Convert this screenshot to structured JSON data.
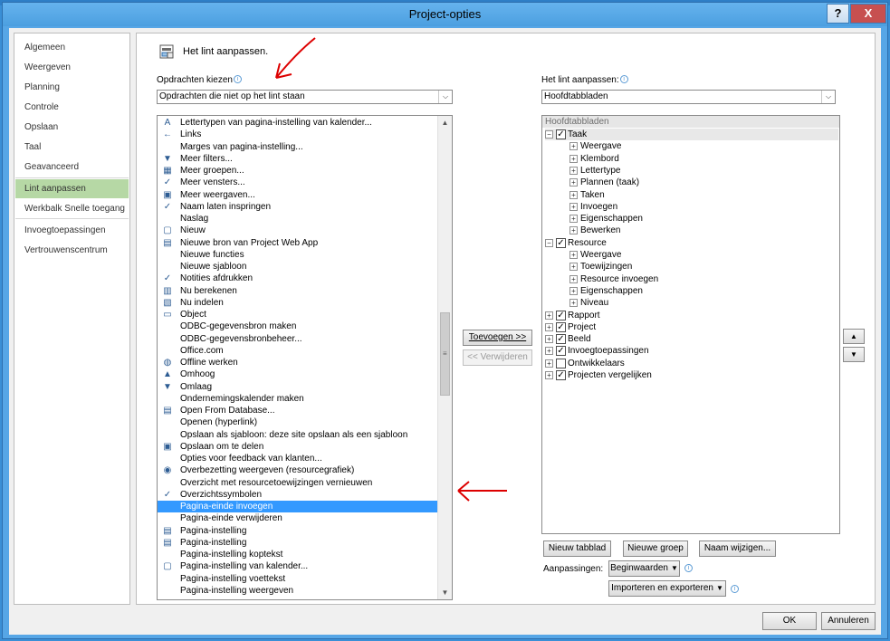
{
  "window": {
    "title": "Project-opties",
    "help": "?",
    "close": "X"
  },
  "nav": {
    "items": [
      {
        "label": "Algemeen"
      },
      {
        "label": "Weergeven"
      },
      {
        "label": "Planning"
      },
      {
        "label": "Controle"
      },
      {
        "label": "Opslaan"
      },
      {
        "label": "Taal"
      },
      {
        "label": "Geavanceerd"
      },
      {
        "label": "Lint aanpassen"
      },
      {
        "label": "Werkbalk Snelle toegang"
      },
      {
        "label": "Invoegtoepassingen"
      },
      {
        "label": "Vertrouwenscentrum"
      }
    ],
    "selected_index": 7
  },
  "header": {
    "title": "Het lint aanpassen."
  },
  "left": {
    "label": "Opdrachten kiezen",
    "combo_value": "Opdrachten die niet op het lint staan",
    "commands": [
      {
        "icon": "font-icon",
        "glyph": "A",
        "label": "Lettertypen van pagina-instelling van kalender..."
      },
      {
        "icon": "arrow-left-icon",
        "glyph": "←",
        "label": "Links"
      },
      {
        "icon": "",
        "glyph": "",
        "label": "Marges van pagina-instelling..."
      },
      {
        "icon": "filter-icon",
        "glyph": "▼",
        "label": "Meer filters..."
      },
      {
        "icon": "groups-icon",
        "glyph": "▦",
        "label": "Meer groepen..."
      },
      {
        "icon": "check-icon",
        "glyph": "✓",
        "label": "Meer vensters..."
      },
      {
        "icon": "views-icon",
        "glyph": "▣",
        "label": "Meer weergaven..."
      },
      {
        "icon": "check-icon",
        "glyph": "✓",
        "label": "Naam laten inspringen"
      },
      {
        "icon": "",
        "glyph": "",
        "label": "Naslag"
      },
      {
        "icon": "new-icon",
        "glyph": "▢",
        "label": "Nieuw"
      },
      {
        "icon": "web-app-icon",
        "glyph": "▤",
        "label": "Nieuwe bron van Project Web App"
      },
      {
        "icon": "",
        "glyph": "",
        "label": "Nieuwe functies"
      },
      {
        "icon": "",
        "glyph": "",
        "label": "Nieuwe sjabloon"
      },
      {
        "icon": "check-icon",
        "glyph": "✓",
        "label": "Notities afdrukken"
      },
      {
        "icon": "calculator-icon",
        "glyph": "▥",
        "label": "Nu berekenen"
      },
      {
        "icon": "level-icon",
        "glyph": "▧",
        "label": "Nu indelen"
      },
      {
        "icon": "object-icon",
        "glyph": "▭",
        "label": "Object"
      },
      {
        "icon": "",
        "glyph": "",
        "label": "ODBC-gegevensbron maken"
      },
      {
        "icon": "",
        "glyph": "",
        "label": "ODBC-gegevensbronbeheer..."
      },
      {
        "icon": "",
        "glyph": "",
        "label": "Office.com"
      },
      {
        "icon": "globe-icon",
        "glyph": "◍",
        "label": "Offline werken"
      },
      {
        "icon": "up-icon",
        "glyph": "▲",
        "label": "Omhoog"
      },
      {
        "icon": "down-icon",
        "glyph": "▼",
        "label": "Omlaag"
      },
      {
        "icon": "",
        "glyph": "",
        "label": "Ondernemingskalender maken"
      },
      {
        "icon": "database-icon",
        "glyph": "▤",
        "label": "Open From Database..."
      },
      {
        "icon": "",
        "glyph": "",
        "label": "Openen (hyperlink)"
      },
      {
        "icon": "",
        "glyph": "",
        "label": "Opslaan als sjabloon: deze site opslaan als een sjabloon"
      },
      {
        "icon": "share-icon",
        "glyph": "▣",
        "label": "Opslaan om te delen"
      },
      {
        "icon": "",
        "glyph": "",
        "label": "Opties voor feedback van klanten..."
      },
      {
        "icon": "overlap-icon",
        "glyph": "◉",
        "label": "Overbezetting weergeven (resourcegrafiek)"
      },
      {
        "icon": "",
        "glyph": "",
        "label": "Overzicht met resourcetoewijzingen vernieuwen"
      },
      {
        "icon": "check-icon",
        "glyph": "✓",
        "label": "Overzichtssymbolen"
      },
      {
        "icon": "",
        "glyph": "",
        "label": "Pagina-einde invoegen"
      },
      {
        "icon": "",
        "glyph": "",
        "label": "Pagina-einde verwijderen"
      },
      {
        "icon": "page-setup-icon",
        "glyph": "▤",
        "label": "Pagina-instelling"
      },
      {
        "icon": "page-setup-icon",
        "glyph": "▤",
        "label": "Pagina-instelling"
      },
      {
        "icon": "",
        "glyph": "",
        "label": "Pagina-instelling koptekst"
      },
      {
        "icon": "page-setup-icon",
        "glyph": "▢",
        "label": "Pagina-instelling van kalender..."
      },
      {
        "icon": "",
        "glyph": "",
        "label": "Pagina-instelling voettekst"
      },
      {
        "icon": "",
        "glyph": "",
        "label": "Pagina-instelling weergeven"
      }
    ],
    "selected_index": 32
  },
  "actions": {
    "add": "Toevoegen >>",
    "remove": "<< Verwijderen"
  },
  "right": {
    "label": "Het lint aanpassen:",
    "combo_value": "Hoofdtabbladen",
    "tree_header": "Hoofdtabbladen",
    "nodes": [
      {
        "level": 0,
        "exp": "⊟",
        "check": true,
        "label": "Taak",
        "hl": true
      },
      {
        "level": 1,
        "exp": "⊞",
        "check": null,
        "label": "Weergave"
      },
      {
        "level": 1,
        "exp": "⊞",
        "check": null,
        "label": "Klembord"
      },
      {
        "level": 1,
        "exp": "⊞",
        "check": null,
        "label": "Lettertype"
      },
      {
        "level": 1,
        "exp": "⊞",
        "check": null,
        "label": "Plannen (taak)"
      },
      {
        "level": 1,
        "exp": "⊞",
        "check": null,
        "label": "Taken"
      },
      {
        "level": 1,
        "exp": "⊞",
        "check": null,
        "label": "Invoegen"
      },
      {
        "level": 1,
        "exp": "⊞",
        "check": null,
        "label": "Eigenschappen"
      },
      {
        "level": 1,
        "exp": "⊞",
        "check": null,
        "label": "Bewerken"
      },
      {
        "level": 0,
        "exp": "⊟",
        "check": true,
        "label": "Resource"
      },
      {
        "level": 1,
        "exp": "⊞",
        "check": null,
        "label": "Weergave"
      },
      {
        "level": 1,
        "exp": "⊞",
        "check": null,
        "label": "Toewijzingen"
      },
      {
        "level": 1,
        "exp": "⊞",
        "check": null,
        "label": "Resource invoegen"
      },
      {
        "level": 1,
        "exp": "⊞",
        "check": null,
        "label": "Eigenschappen"
      },
      {
        "level": 1,
        "exp": "⊞",
        "check": null,
        "label": "Niveau"
      },
      {
        "level": 0,
        "exp": "⊞",
        "check": true,
        "label": "Rapport"
      },
      {
        "level": 0,
        "exp": "⊞",
        "check": true,
        "label": "Project"
      },
      {
        "level": 0,
        "exp": "⊞",
        "check": true,
        "label": "Beeld"
      },
      {
        "level": 0,
        "exp": "⊞",
        "check": true,
        "label": "Invoegtoepassingen"
      },
      {
        "level": 0,
        "exp": "⊞",
        "check": false,
        "label": "Ontwikkelaars"
      },
      {
        "level": 0,
        "exp": "⊞",
        "check": true,
        "label": "Projecten vergelijken"
      }
    ],
    "new_tab": "Nieuw tabblad",
    "new_group": "Nieuwe groep",
    "rename": "Naam wijzigen...",
    "customizations_label": "Aanpassingen:",
    "reset": "Beginwaarden",
    "import_export": "Importeren en exporteren"
  },
  "footer": {
    "ok": "OK",
    "cancel": "Annuleren"
  }
}
